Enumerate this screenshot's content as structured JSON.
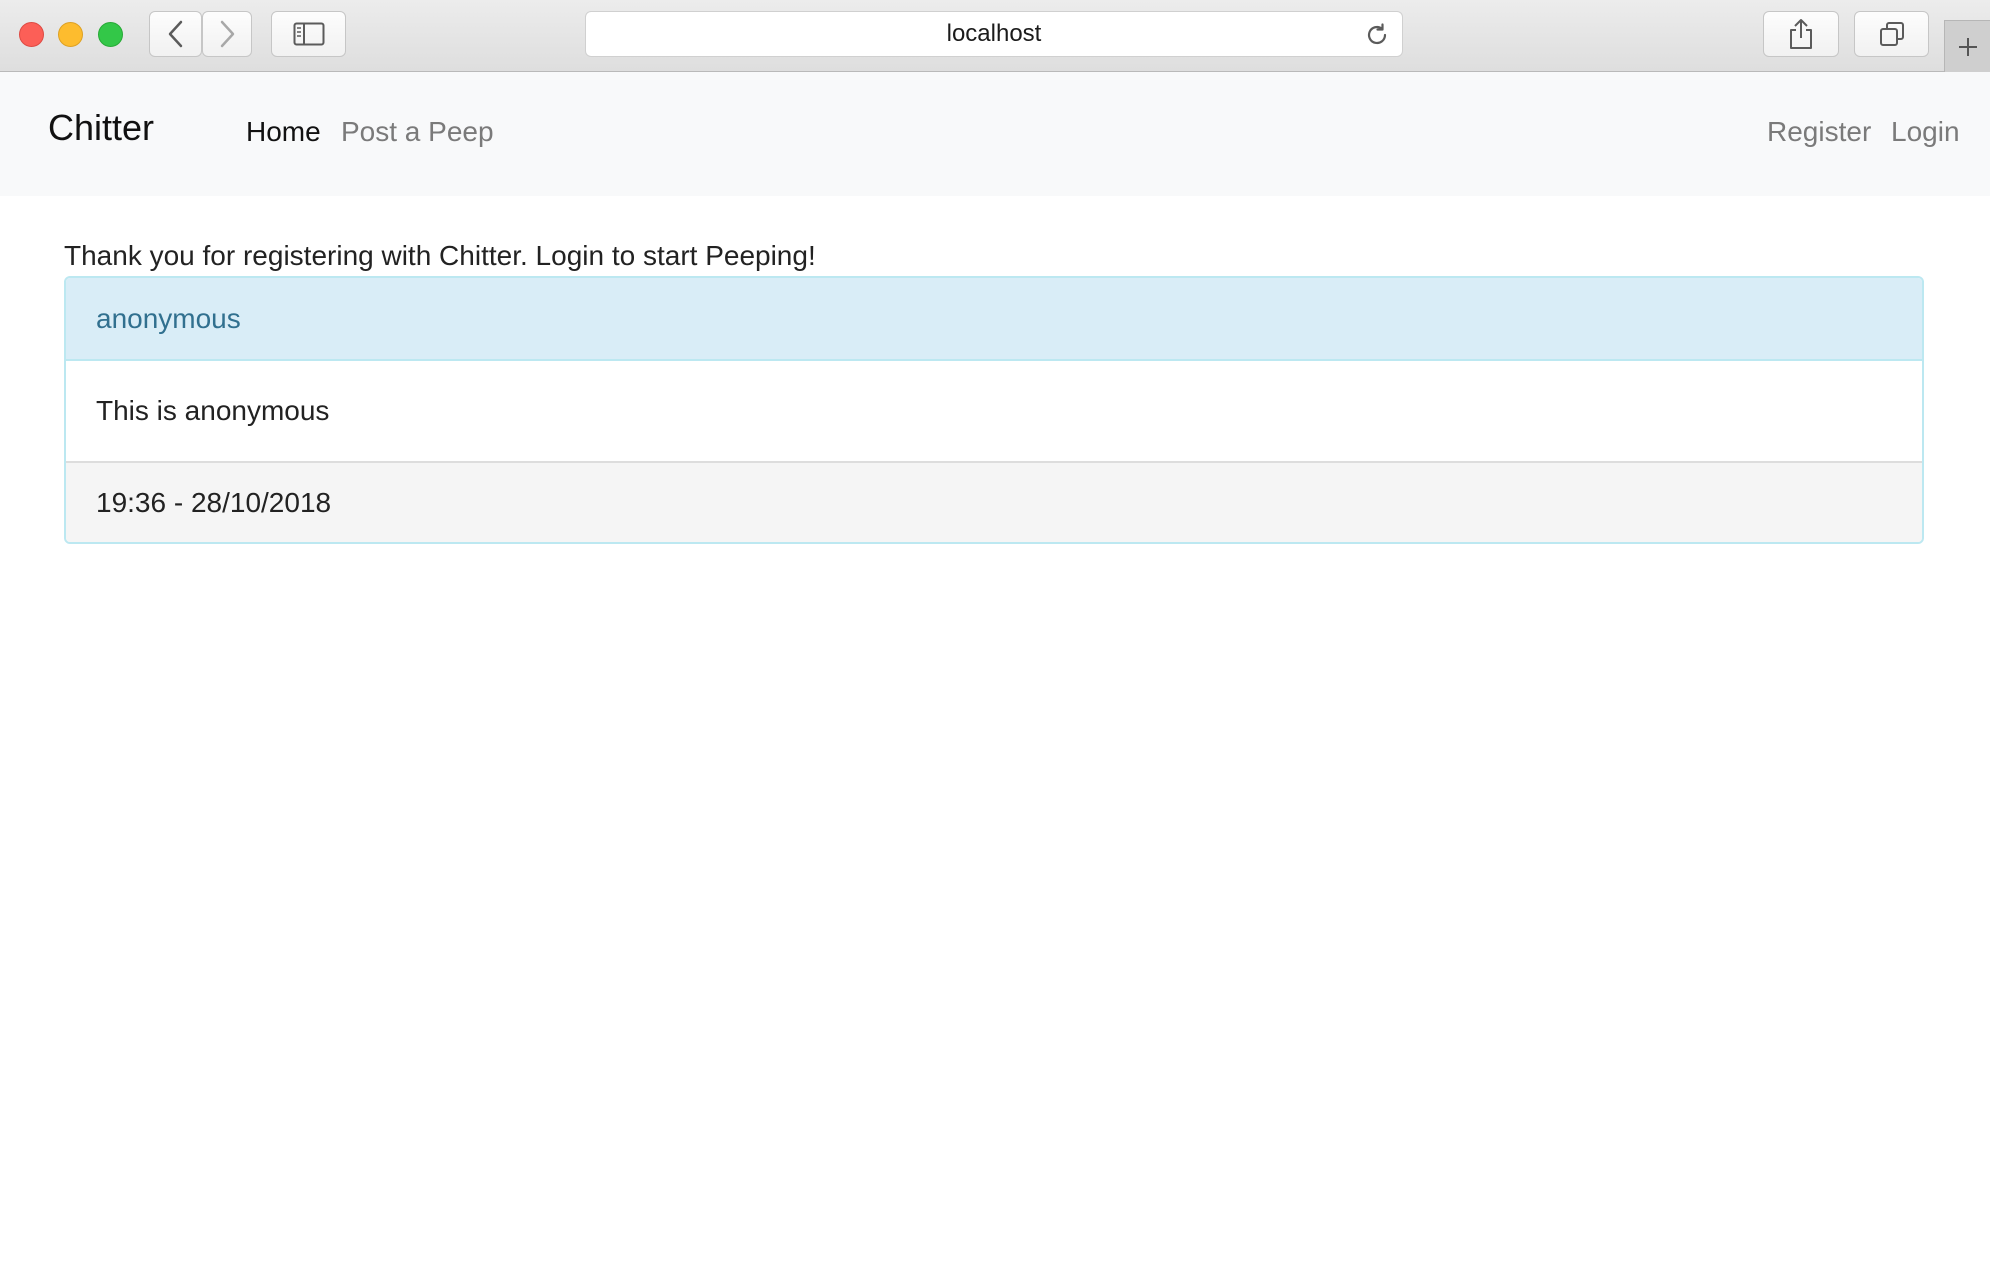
{
  "browser": {
    "url": "localhost"
  },
  "navbar": {
    "brand": "Chitter",
    "links": {
      "home": "Home",
      "post_peep": "Post a Peep",
      "register": "Register",
      "login": "Login"
    }
  },
  "main": {
    "message": "Thank you for registering with Chitter. Login to start Peeping!",
    "peeps": [
      {
        "author": "anonymous",
        "text": "This is anonymous",
        "timestamp": "19:36 - 28/10/2018"
      }
    ]
  },
  "colors": {
    "card_header_bg": "#d9edf7",
    "card_header_text": "#31708f",
    "card_border": "#bce8f1",
    "navbar_bg": "#f8f9fa"
  },
  "icons": {
    "back": "chevron-left-icon",
    "forward": "chevron-right-icon",
    "sidebar": "sidebar-icon",
    "reload": "reload-icon",
    "share": "share-icon",
    "tabs": "tabs-icon",
    "new_tab": "plus-icon"
  }
}
